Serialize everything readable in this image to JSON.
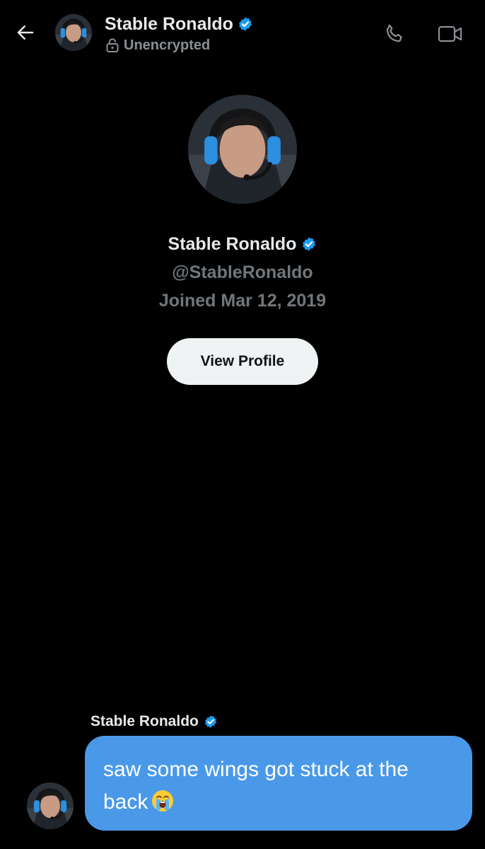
{
  "header": {
    "name": "Stable Ronaldo",
    "status": "Unencrypted",
    "verified_icon": "verified-badge-icon",
    "back_icon": "arrow-left-icon",
    "call_icon": "phone-icon",
    "video_icon": "video-camera-icon"
  },
  "profile": {
    "name": "Stable Ronaldo",
    "handle": "@StableRonaldo",
    "joined": "Joined Mar 12, 2019",
    "button_label": "View Profile"
  },
  "message": {
    "sender": "Stable Ronaldo",
    "text": "saw some wings got stuck at the back",
    "emoji": "loudly-crying-face-icon"
  },
  "colors": {
    "background": "#000000",
    "verified": "#1d9bf0",
    "bubble": "#4a99e9",
    "button": "#eff3f4",
    "muted_text": "#71767b"
  }
}
